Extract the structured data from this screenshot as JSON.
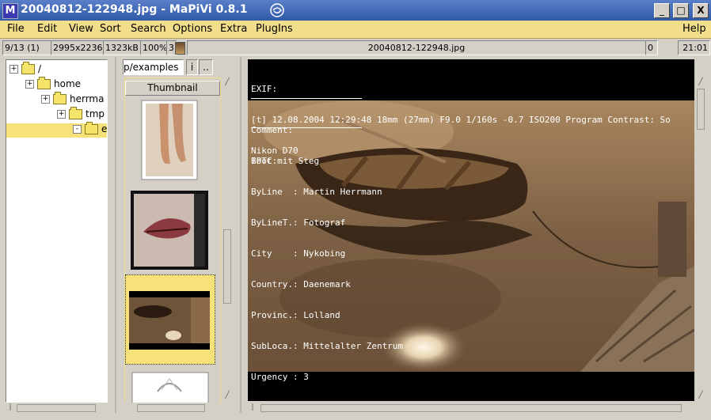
{
  "window": {
    "title": "20040812-122948.jpg - MaPiVi 0.8.1",
    "app_icon_letter": "M",
    "buttons": {
      "minimize": "_",
      "maximize": "□",
      "close": "X"
    }
  },
  "menu": {
    "items": [
      "File",
      "Edit",
      "View",
      "Sort",
      "Search",
      "Options",
      "Extra",
      "PlugIns"
    ],
    "help": "Help"
  },
  "status": {
    "position": "9/13 (1)",
    "dimensions": "2995x2236",
    "filesize": "1323kB",
    "zoom": "100%",
    "rating": "3",
    "filename": "20040812-122948.jpg",
    "count": "0",
    "time": "21:01"
  },
  "tree": {
    "nodes": [
      {
        "label": "/",
        "depth": 0,
        "expander": "+"
      },
      {
        "label": "home",
        "depth": 1,
        "expander": "+"
      },
      {
        "label": "herrma",
        "depth": 2,
        "expander": "+"
      },
      {
        "label": "tmp",
        "depth": 3,
        "expander": "+"
      },
      {
        "label": "e",
        "depth": 4,
        "expander": "-",
        "selected": true
      }
    ]
  },
  "thumbnails": {
    "path_tab": "p/examples",
    "tab_i": "i",
    "tab_up": "..",
    "header": "Thumbnail",
    "items": [
      {
        "name": "feet-thumbnail",
        "selected": false
      },
      {
        "name": "lips-thumbnail",
        "selected": false
      },
      {
        "name": "boat-thumbnail",
        "selected": true
      },
      {
        "name": "flower-thumbnail",
        "selected": false
      }
    ]
  },
  "viewer": {
    "exif_lines": [
      "EXIF:",
      "[t] 12.08.2004 12:29:48 18mm (27mm) F9.0 1/160s -0.7 ISO200 Program Contrast: So",
      "Nikon D70"
    ],
    "comment_lines": [
      "Comment:",
      "Boot mit Steg"
    ],
    "iptc_lines": [
      "IPTC:",
      "ByLine  : Martin Herrmann",
      "ByLineT.: Fotograf",
      "City    : Nykobing",
      "Country.: Daenemark",
      "Provinc.: Lolland",
      "SubLoca.: Mittelalter Zentrum",
      "Urgency : 3"
    ]
  },
  "colors": {
    "menubar": "#f2dd8a",
    "selection": "#f7e27a",
    "titlebar": "#2f5aa8"
  }
}
